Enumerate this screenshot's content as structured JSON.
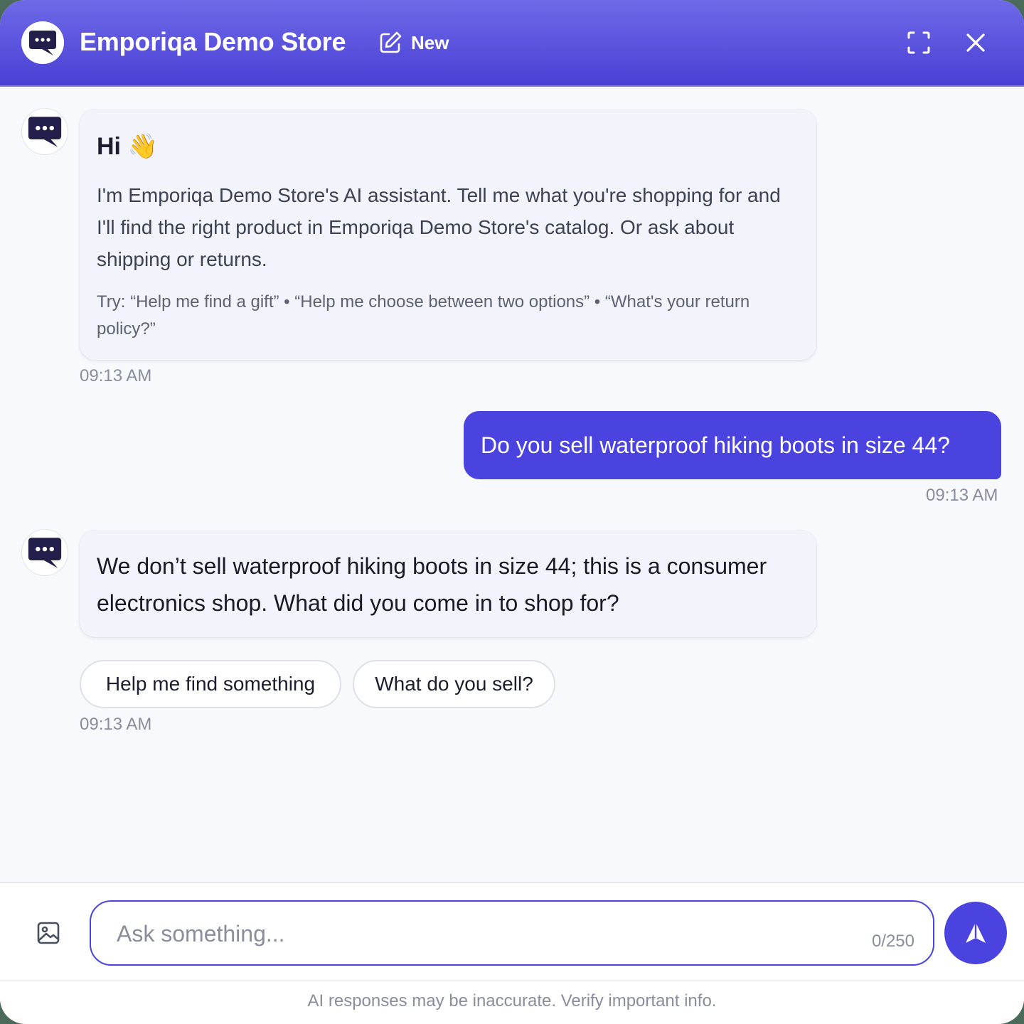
{
  "header": {
    "title": "Emporiqa Demo Store",
    "new_label": "New"
  },
  "messages": [
    {
      "role": "assistant",
      "greeting": "Hi 👋",
      "text": "I'm Emporiqa Demo Store's AI assistant. Tell me what you're shopping for and I'll find the right product in Emporiqa Demo Store's catalog. Or ask about shipping or returns.",
      "try": "Try: “Help me find a gift” • “Help me choose between two options” • “What's your return policy?”",
      "time": "09:13 AM"
    },
    {
      "role": "user",
      "text": "Do you sell waterproof hiking boots in size 44?",
      "time": "09:13 AM"
    },
    {
      "role": "assistant",
      "text": "We don’t sell waterproof hiking boots in size 44; this is a consumer electronics shop. What did you come in to shop for?",
      "suggestions": [
        "Help me find something",
        "What do you sell?"
      ],
      "time": "09:13 AM"
    }
  ],
  "composer": {
    "placeholder": "Ask something...",
    "counter": "0/250"
  },
  "footer": {
    "disclaimer": "AI responses may be inaccurate. Verify important info."
  },
  "colors": {
    "accent": "#4b43e0",
    "header_gradient_top": "#6e6ae8",
    "avatar_dark": "#22204a"
  },
  "icons": [
    "chat-bubble-icon",
    "edit-icon",
    "fullscreen-icon",
    "close-icon",
    "image-icon",
    "send-icon"
  ]
}
